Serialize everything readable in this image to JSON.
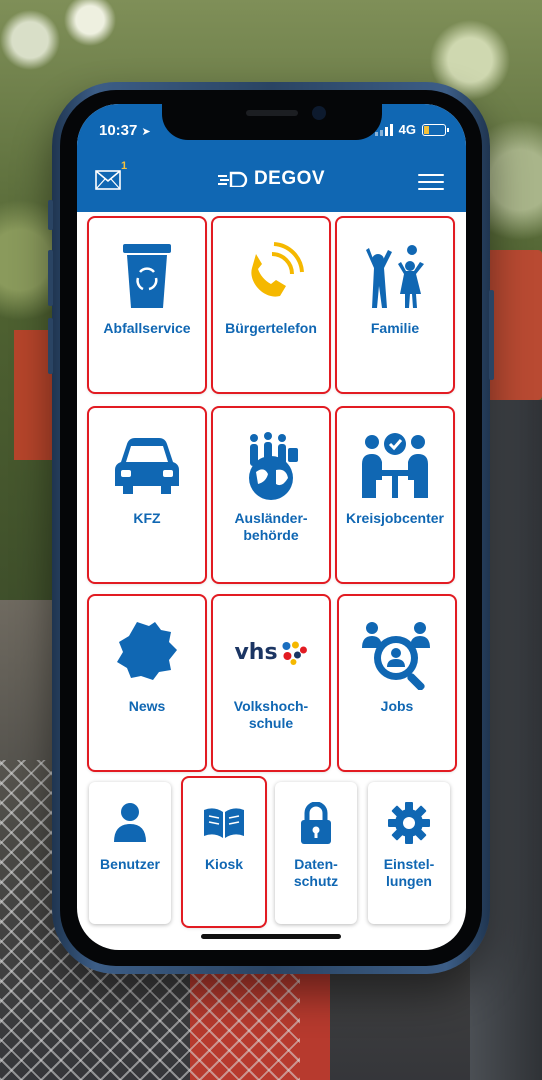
{
  "status": {
    "time": "10:37",
    "network": "4G"
  },
  "header": {
    "brand": "DEGOV",
    "mail_badge": "1"
  },
  "tiles": [
    {
      "label": "Abfallservice",
      "icon": "trash-bin-icon"
    },
    {
      "label": "Bürgertelefon",
      "icon": "phone-icon"
    },
    {
      "label": "Familie",
      "icon": "family-icon"
    },
    {
      "label": "KFZ",
      "icon": "car-icon"
    },
    {
      "label": "Ausländer-\nbehörde",
      "icon": "globe-people-icon"
    },
    {
      "label": "Kreisjobcenter",
      "icon": "meeting-icon"
    },
    {
      "label": "News",
      "icon": "map-region-icon"
    },
    {
      "label": "Volkshoch-\nschule",
      "icon": "vhs-logo-icon"
    },
    {
      "label": "Jobs",
      "icon": "job-search-icon"
    }
  ],
  "small_tiles": [
    {
      "label": "Benutzer",
      "icon": "user-icon"
    },
    {
      "label": "Kiosk",
      "icon": "book-icon"
    },
    {
      "label": "Daten-\nschutz",
      "icon": "lock-icon"
    },
    {
      "label": "Einstel-\nlungen",
      "icon": "gear-icon"
    }
  ],
  "vhs_text": "vhs",
  "colors": {
    "primary": "#1067b3",
    "accent": "#f5b800",
    "highlight": "#e21b22"
  }
}
